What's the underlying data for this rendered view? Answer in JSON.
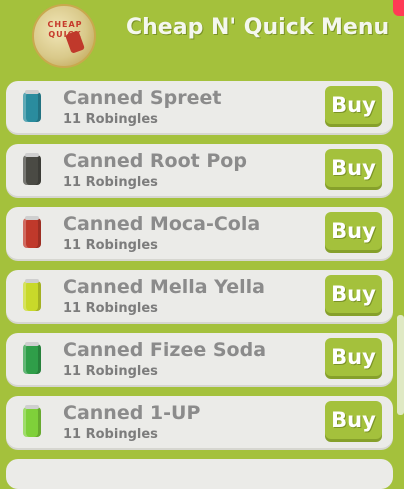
{
  "header": {
    "title": "Cheap N' Quick Menu",
    "logo_text": "CHEAP QUICK"
  },
  "items": [
    {
      "name": "Canned Spreet",
      "price": "11 Robingles",
      "buy_label": "Buy",
      "can_color": "#2a8c9e",
      "can_icon": "spreet-can-icon"
    },
    {
      "name": "Canned Root Pop",
      "price": "11 Robingles",
      "buy_label": "Buy",
      "can_color": "#4a4a44",
      "can_icon": "root-pop-can-icon"
    },
    {
      "name": "Canned Moca-Cola",
      "price": "11 Robingles",
      "buy_label": "Buy",
      "can_color": "#c0392b",
      "can_icon": "moca-cola-can-icon"
    },
    {
      "name": "Canned Mella Yella",
      "price": "11 Robingles",
      "buy_label": "Buy",
      "can_color": "#c8d92a",
      "can_icon": "mella-yella-can-icon"
    },
    {
      "name": "Canned Fizee Soda",
      "price": "11 Robingles",
      "buy_label": "Buy",
      "can_color": "#2f9e49",
      "can_icon": "fizee-soda-can-icon"
    },
    {
      "name": "Canned 1-UP",
      "price": "11 Robingles",
      "buy_label": "Buy",
      "can_color": "#7fd03a",
      "can_icon": "one-up-can-icon"
    }
  ],
  "colors": {
    "background": "#a4c13c",
    "card": "#ebebe8",
    "button": "#a4c13c",
    "close_tab": "#ff3a55"
  }
}
